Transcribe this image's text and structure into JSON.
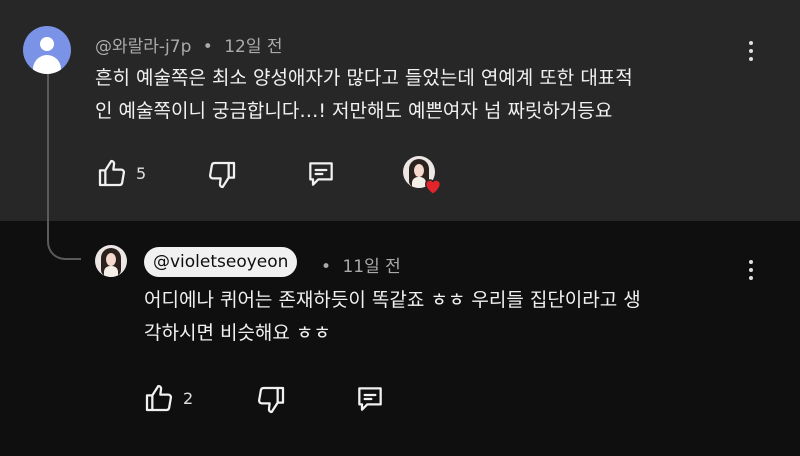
{
  "comment": {
    "author": "@와랄라-j7p",
    "separator": "•",
    "time": "12일 전",
    "text_line1": "흔히 예술쪽은 최소 양성애자가 많다고 들었는데 연예계 또한 대표적",
    "text_line2": "인 예술쪽이니 궁금합니다…! 저만해도 예쁜여자 넘 짜릿하거등요",
    "like_count": "5",
    "creator_hearted": true
  },
  "reply": {
    "author": "@violetseoyeon",
    "separator": "•",
    "time": "11일 전",
    "text_line1": "어디에나 퀴어는 존재하듯이 똑같죠 ㅎㅎ 우리들 집단이라고 생",
    "text_line2": "각하시면 비슷해요 ㅎㅎ",
    "like_count": "2"
  },
  "icons": {
    "like": "thumbs-up-icon",
    "dislike": "thumbs-down-icon",
    "reply": "reply-comment-icon",
    "more": "more-vert-icon",
    "heart": "heart-icon",
    "default_avatar": "default-user-avatar"
  },
  "colors": {
    "top_background": "#272727",
    "bottom_background": "#0f0f0f",
    "heart": "#e1252b",
    "default_avatar": "#7b93e6"
  }
}
